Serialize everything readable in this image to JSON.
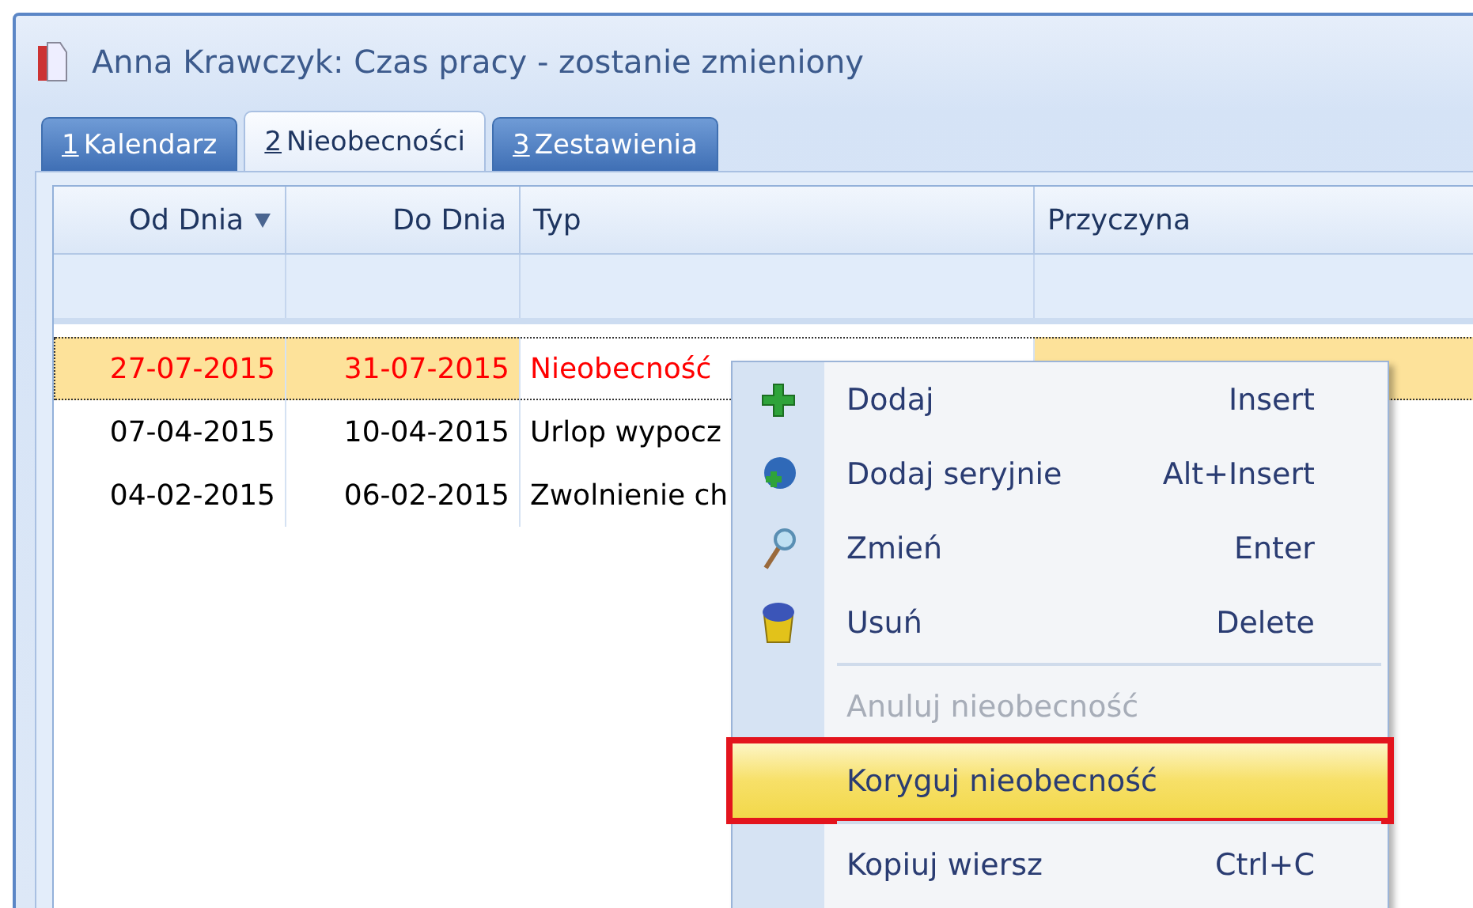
{
  "window": {
    "title": "Anna Krawczyk: Czas pracy - zostanie zmieniony"
  },
  "tabs": [
    {
      "hotkey": "1",
      "label": "Kalendarz",
      "selected": false
    },
    {
      "hotkey": "2",
      "label": "Nieobecności",
      "selected": true
    },
    {
      "hotkey": "3",
      "label": "Zestawienia",
      "selected": false
    }
  ],
  "table": {
    "columns": [
      {
        "label": "Od Dnia",
        "sorted": true
      },
      {
        "label": "Do Dnia",
        "sorted": false
      },
      {
        "label": "Typ",
        "sorted": false
      },
      {
        "label": "Przyczyna",
        "sorted": false
      }
    ],
    "rows": [
      {
        "cells": [
          "27-07-2015",
          "31-07-2015",
          "Nieobecność"
        ],
        "selected": true,
        "color": "#ff0000"
      },
      {
        "cells": [
          "07-04-2015",
          "10-04-2015",
          "Urlop wypocz"
        ],
        "selected": false,
        "color": "#000000"
      },
      {
        "cells": [
          "04-02-2015",
          "06-02-2015",
          "Zwolnienie ch"
        ],
        "selected": false,
        "color": "#000000"
      }
    ]
  },
  "context_menu": {
    "items": [
      {
        "kind": "add",
        "label": "Dodaj",
        "shortcut": "Insert",
        "disabled": false,
        "selected": false,
        "outlined": false
      },
      {
        "kind": "series",
        "label": "Dodaj seryjnie",
        "shortcut": "Alt+Insert",
        "disabled": false,
        "selected": false,
        "outlined": false
      },
      {
        "kind": "edit",
        "label": "Zmień",
        "shortcut": "Enter",
        "disabled": false,
        "selected": false,
        "outlined": false
      },
      {
        "kind": "delete",
        "label": "Usuń",
        "shortcut": "Delete",
        "disabled": false,
        "selected": false,
        "outlined": false
      },
      {
        "kind": "separator"
      },
      {
        "kind": "item",
        "label": "Anuluj nieobecność",
        "disabled": true,
        "selected": false,
        "outlined": false
      },
      {
        "kind": "item",
        "label": "Koryguj nieobecność",
        "disabled": false,
        "selected": true,
        "outlined": true
      },
      {
        "kind": "separator"
      },
      {
        "kind": "item",
        "label": "Kopiuj wiersz",
        "shortcut": "Ctrl+C",
        "disabled": false,
        "selected": false,
        "outlined": false
      }
    ]
  }
}
